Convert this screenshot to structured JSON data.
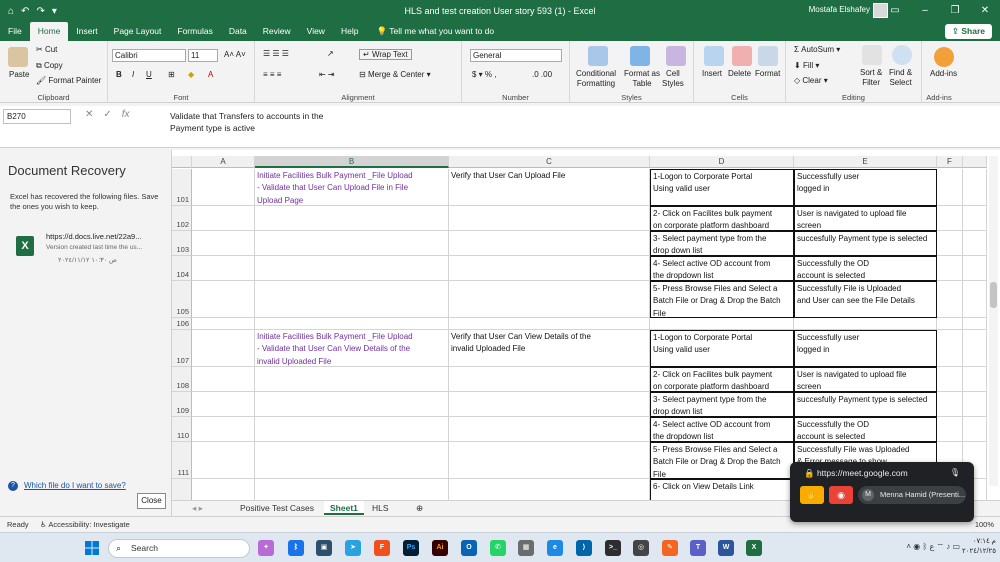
{
  "window": {
    "title": "HLS and test creation User story 593 (1)  -  Excel",
    "user": "Mostafa Elshafey"
  },
  "ribbon_tabs": [
    "File",
    "Home",
    "Insert",
    "Page Layout",
    "Formulas",
    "Data",
    "Review",
    "View",
    "Help"
  ],
  "tell_me": "Tell me what you want to do",
  "share_label": "Share",
  "ribbon": {
    "clipboard": {
      "label": "Clipboard",
      "paste": "Paste",
      "cut": "Cut",
      "copy": "Copy",
      "format_painter": "Format Painter"
    },
    "font": {
      "label": "Font",
      "name": "Calibri",
      "size": "11"
    },
    "alignment": {
      "label": "Alignment",
      "wrap": "Wrap Text",
      "merge": "Merge & Center"
    },
    "number": {
      "label": "Number",
      "format": "General"
    },
    "styles": {
      "label": "Styles",
      "cond": "Conditional\nFormatting",
      "table": "Format as\nTable",
      "cell": "Cell\nStyles"
    },
    "cells": {
      "label": "Cells",
      "insert": "Insert",
      "delete": "Delete",
      "format": "Format"
    },
    "editing": {
      "label": "Editing",
      "autosum": "AutoSum",
      "fill": "Fill",
      "clear": "Clear",
      "sort": "Sort &\nFilter",
      "find": "Find &\nSelect"
    },
    "addins": {
      "label": "Add-ins",
      "btn": "Add-ins"
    }
  },
  "formula_bar": {
    "name_box": "B270",
    "content": "Validate that Transfers to accounts in the\n   Payment type is active"
  },
  "recovery": {
    "title": "Document Recovery",
    "description": "Excel has recovered the following files. Save the ones you wish to keep.",
    "file_name": "https://d.docs.live.net/22a9...",
    "file_meta": "Version created last time the us...",
    "file_time": "ص ١٠:٣٠ ٢٠٢٤/١١/١٢",
    "help_link": "Which file do I want to save?",
    "close_label": "Close"
  },
  "grid": {
    "columns": [
      "A",
      "B",
      "C",
      "D",
      "E",
      "F"
    ],
    "rows": [
      {
        "num": "101",
        "b": " Initiate Facilities Bulk Payment _File Upload\n - Validate that User Can Upload File in File\nUpload Page",
        "c": "Verify that User Can Upload File",
        "d": "1-Logon to Corporate Portal\n Using valid user",
        "e": "Successfully user\n logged in"
      },
      {
        "num": "102",
        "b": "",
        "c": "",
        "d": "2- Click on Facilites bulk payment\non corporate platform dashboard",
        "e": "User is navigated to upload file\nscreen"
      },
      {
        "num": "103",
        "b": "",
        "c": "",
        "d": "3- Select payment type from the\ndrop down list",
        "e": "succesfully Payment type is selected"
      },
      {
        "num": "104",
        "b": "",
        "c": "",
        "d": "4- Select active OD account from\nthe dropdown list",
        "e": "Successfully the OD\naccount is selected"
      },
      {
        "num": "105",
        "b": "",
        "c": "",
        "d": "5- Press Browse Files and Select a\nBatch File or Drag & Drop the Batch\nFile",
        "e": "Successfully File is Uploaded\n and  User can see the File Details"
      },
      {
        "num": "106",
        "b": "",
        "c": "",
        "d": "",
        "e": ""
      },
      {
        "num": "107",
        "b": " Initiate Facilities Bulk Payment _File Upload\n - Validate that User Can View Details of the\n invalid Uploaded File",
        "c": "Verify that User Can View Details of the\n invalid Uploaded File",
        "d": "1-Logon to Corporate Portal\n Using valid user",
        "e": "Successfully user\n logged in"
      },
      {
        "num": "108",
        "b": "",
        "c": "",
        "d": "2- Click on Facilites bulk payment\non corporate platform dashboard",
        "e": "User is navigated to upload file\nscreen"
      },
      {
        "num": "109",
        "b": "",
        "c": "",
        "d": "3- Select payment type from the\ndrop down list",
        "e": "succesfully Payment type is selected"
      },
      {
        "num": "110",
        "b": "",
        "c": "",
        "d": "4- Select active OD account from\nthe dropdown list",
        "e": "Successfully the OD\naccount is selected"
      },
      {
        "num": "111",
        "b": "",
        "c": "",
        "d": "5- Press Browse Files and Select a\nBatch File or Drag & Drop the Batch\nFile",
        "e": "Successfully File was Uploaded\n & Error message to show"
      },
      {
        "num": "",
        "b": "",
        "c": "",
        "d": "6- Click on View Details Link",
        "e": ""
      }
    ]
  },
  "sheet_tabs": [
    "Positive Test Cases",
    "Sheet1",
    "HLS"
  ],
  "status": {
    "ready": "Ready",
    "accessibility": "Accessibility: Investigate",
    "zoom": "100%"
  },
  "meet": {
    "url": "https://meet.google.com",
    "presenter": "Menna Hamid (Presenti...",
    "initial": "M"
  },
  "taskbar": {
    "search": "Search",
    "clock_time": "م ٠٧:١٤",
    "clock_date": "٢٠٢٤/١٢/٢٥",
    "lang": "ع"
  }
}
